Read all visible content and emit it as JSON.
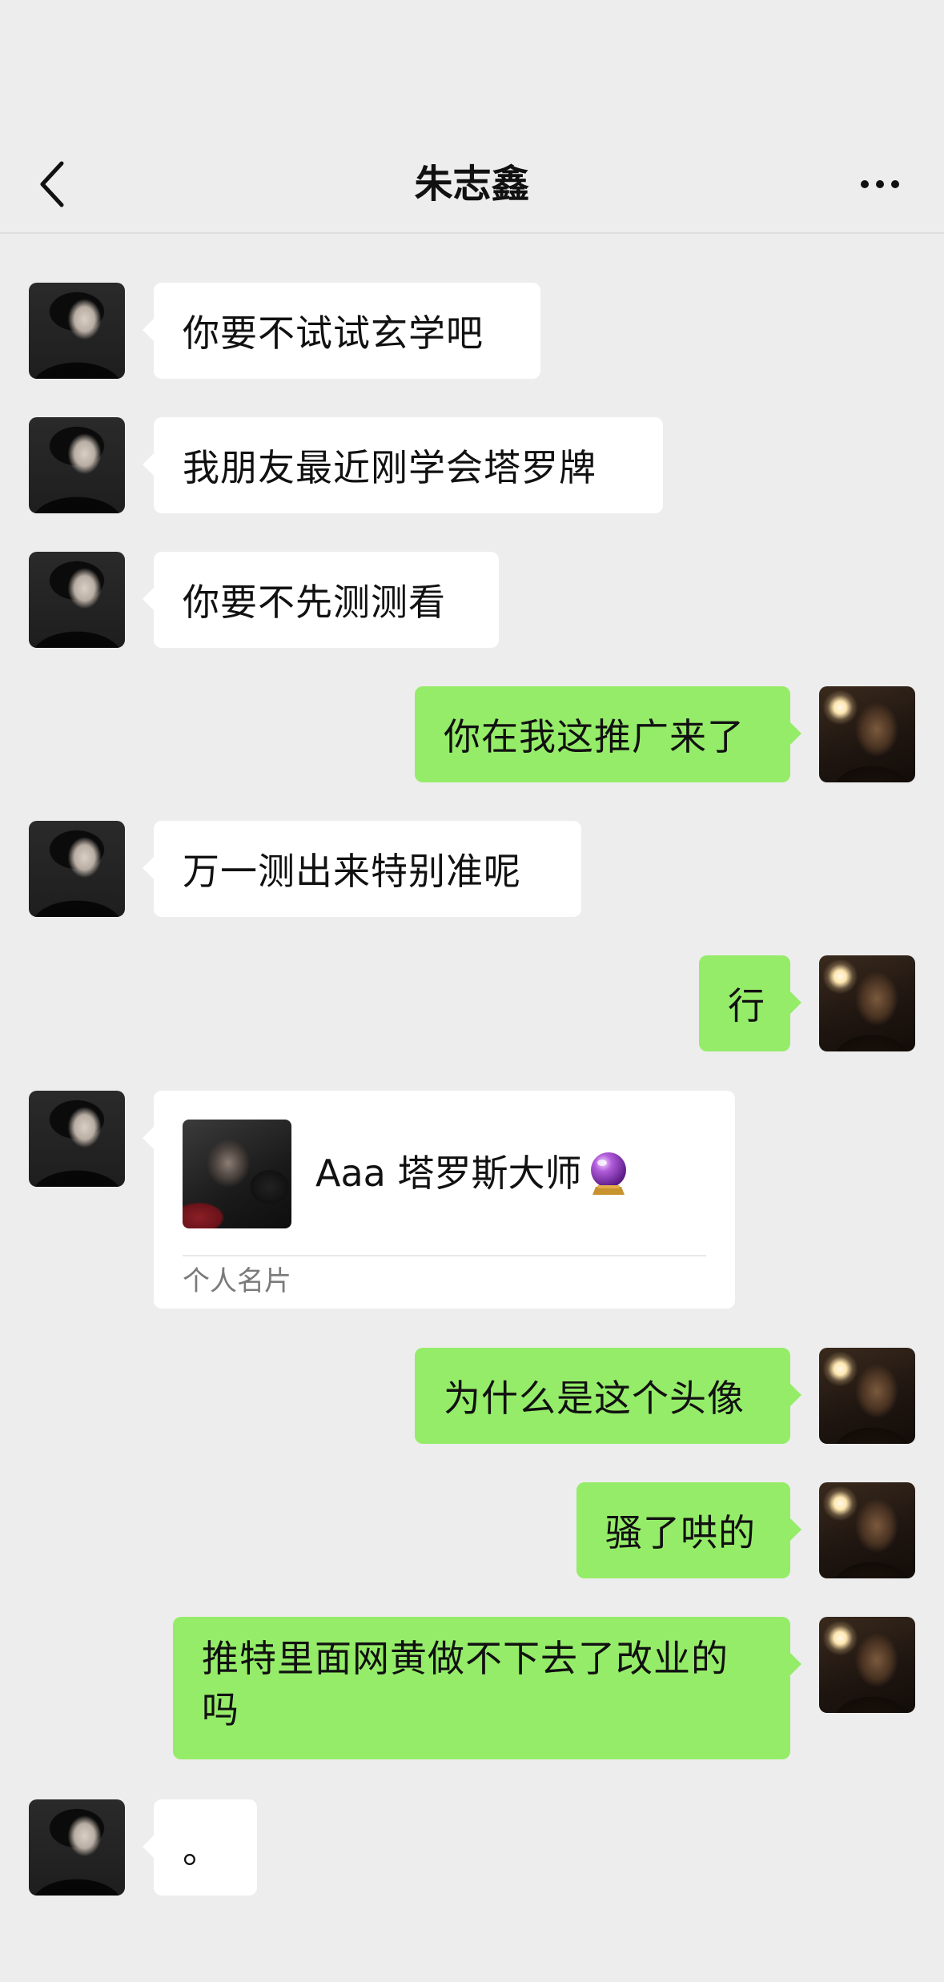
{
  "header": {
    "title": "朱志鑫"
  },
  "messages": [
    {
      "side": "left",
      "text": "你要不试试玄学吧"
    },
    {
      "side": "left",
      "text": "我朋友最近刚学会塔罗牌"
    },
    {
      "side": "left",
      "text": "你要不先测测看"
    },
    {
      "side": "right",
      "text": "你在我这推广来了"
    },
    {
      "side": "left",
      "text": "万一测出来特别准呢"
    },
    {
      "side": "right",
      "text": "行"
    },
    {
      "side": "left",
      "type": "contact-card",
      "name": "Aaa 塔罗斯大师",
      "name_icon": "crystal-ball-icon",
      "card_type": "个人名片"
    },
    {
      "side": "right",
      "text": "为什么是这个头像"
    },
    {
      "side": "right",
      "text": "骚了哄的"
    },
    {
      "side": "right",
      "text": "推特里面网黄做不下去了改业的吗"
    },
    {
      "side": "left",
      "text": "。"
    }
  ],
  "colors": {
    "background": "#ededed",
    "bubble_self": "#95ec69",
    "bubble_other": "#ffffff"
  }
}
